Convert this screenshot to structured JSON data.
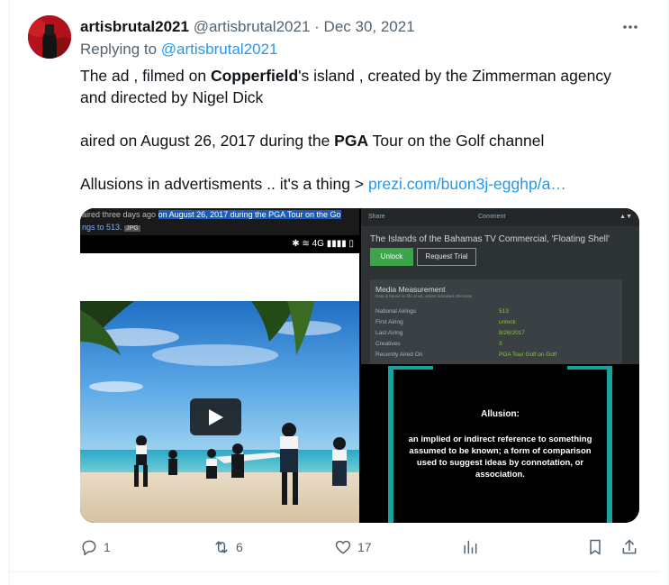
{
  "tweet": {
    "display_name": "artisbrutal2021",
    "handle": "@artisbrutal2021",
    "separator": "·",
    "date": "Dec 30, 2021",
    "more_icon": "more-horizontal-icon",
    "replying_prefix": "Replying to",
    "replying_to": "@artisbrutal2021",
    "body": {
      "p1_a": "The ad , filmed on ",
      "p1_b": "Copperfield",
      "p1_c": "'s island ,  created by the Zimmerman agency and directed by Nigel Dick",
      "p2_a": "aired on August 26, 2017 during the ",
      "p2_b": "PGA",
      "p2_c": " Tour on the Golf channel",
      "p3_a": "Allusions in advertisments .. it's a thing > ",
      "p3_link": "prezi.com/buon3j-egghp/a…"
    }
  },
  "media": {
    "left": {
      "caption_plain": "aired three days ago ",
      "caption_highlight": "on August 26, 2017 during the PGA Tour on the Go",
      "caption_line2_blue": "ngs to 513.",
      "caption_tag": "JPG",
      "status_icons": "✱ ≋ 4G ▮▮▮▮ ▯",
      "play_icon": "play-icon"
    },
    "top_right": {
      "share": "Share",
      "comment": "Comment",
      "title": "The Islands of the Bahamas TV Commercial, 'Floating Shell'",
      "unlock_label": "Unlock",
      "trial_label": "Request Trial",
      "panel_title": "Media Measurement",
      "panel_subtitle": "Data is based on life of ad, unless indicated otherwise",
      "rows": [
        {
          "label": "National Airings",
          "value": "513"
        },
        {
          "label": "First Airing",
          "value": "unlock"
        },
        {
          "label": "Last Airing",
          "value": "8/26/2017"
        },
        {
          "label": "Creatives",
          "value": "3"
        },
        {
          "label": "Recently Aired On",
          "value": "PGA Tour Golf on Golf"
        }
      ]
    },
    "bottom_right": {
      "heading": "Allusion:",
      "definition": "an implied or indirect reference to something assumed to be known; a form of comparison used to suggest ideas by connotation, or association.",
      "accent_color": "#17a2a0"
    }
  },
  "actions": {
    "reply_count": "1",
    "retweet_count": "6",
    "like_count": "17",
    "icons": [
      "reply-icon",
      "retweet-icon",
      "like-icon",
      "views-icon",
      "bookmark-icon",
      "share-icon"
    ]
  },
  "colors": {
    "link": "#1d9bf0",
    "secondary_text": "#536471",
    "primary_text": "#0f1419"
  }
}
